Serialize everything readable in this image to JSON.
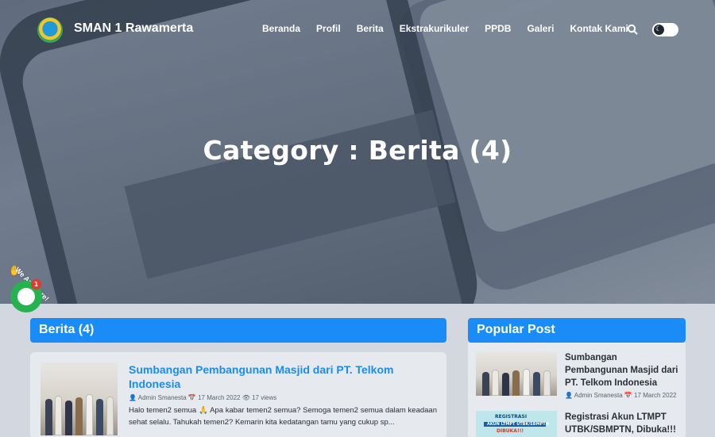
{
  "header": {
    "brand": "SMAN 1 Rawamerta",
    "menu": [
      "Beranda",
      "Profil",
      "Berita",
      "Ekstrakurikuler",
      "PPDB",
      "Galeri",
      "Kontak Kami"
    ]
  },
  "hero": {
    "title": "Category : Berita (4)"
  },
  "main": {
    "section_title": "Berita (4)",
    "post": {
      "title": "Sumbangan Pembangunan Masjid dari PT. Telkom Indonesia",
      "author": "Admin Smanesta",
      "date": "17 March 2022",
      "views": "17 views",
      "excerpt": "Halo temen2 semua 🙏 Apa kabar temen2 semua? Semoga temen2 semua dalam keadaan sehat selalu. Tahukah temen2? Kemarin kita kedatangan tamu yang cukup sp..."
    }
  },
  "sidebar": {
    "title": "Popular Post",
    "items": [
      {
        "title": "Sumbangan Pembangunan Masjid dari PT. Telkom Indonesia",
        "author": "Admin Smanesta",
        "date": "17 March 2022"
      },
      {
        "title": "Registrasi Akun LTMPT UTBK/SBMPTN, Dibuka!!!",
        "image_text_1": "REGISTRASI",
        "image_text_2": "AKUN LTMPT UTBK/SBMPTN",
        "image_text_3": "DIBUKA!!!"
      }
    ]
  },
  "widget": {
    "label": "We Are Here!",
    "badge": "1"
  },
  "colors": {
    "accent": "#1a8cf7",
    "whatsapp": "#25b34f"
  }
}
